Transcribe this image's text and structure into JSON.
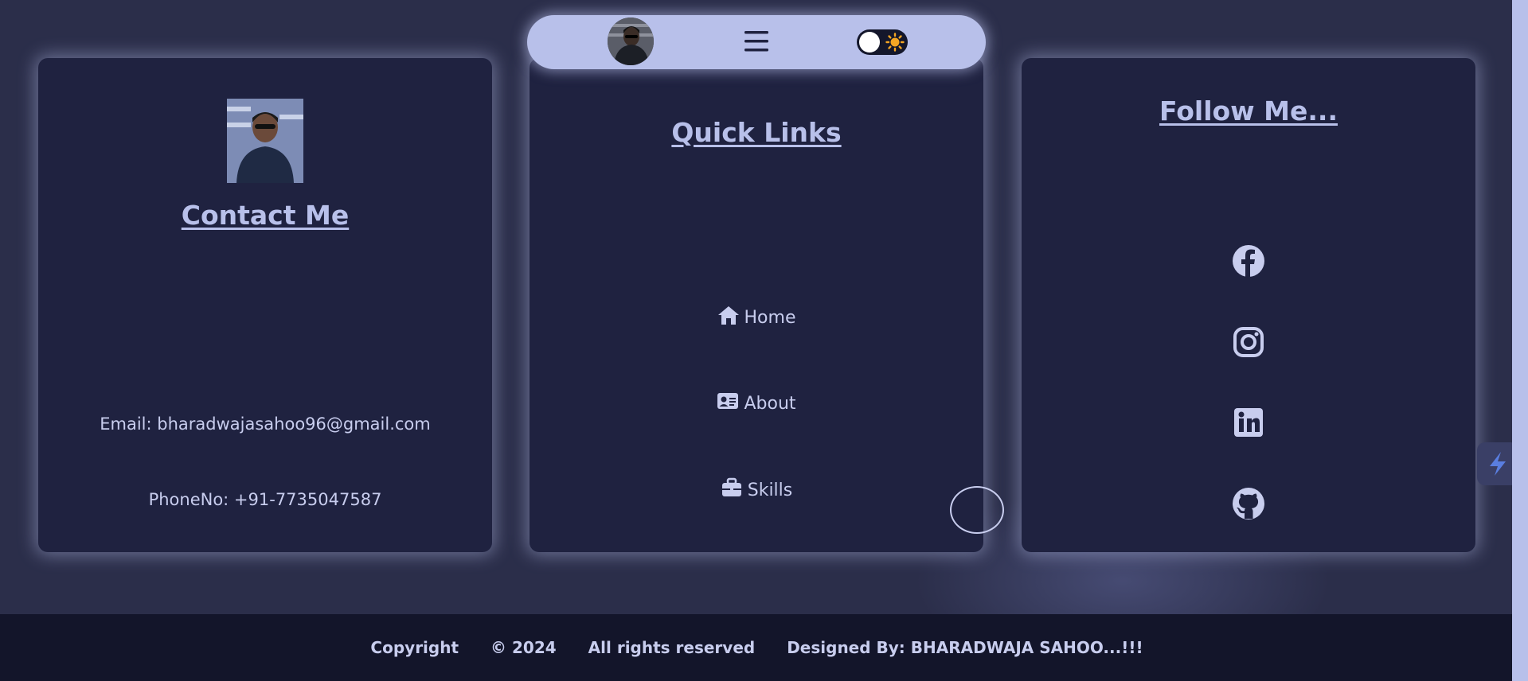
{
  "contact": {
    "heading": "Contact Me",
    "email": "Email: bharadwajasahoo96@gmail.com",
    "phone": "PhoneNo: +91-7735047587"
  },
  "quick_links": {
    "heading": "Quick Links",
    "items": [
      {
        "label": "Home",
        "icon": "home-icon"
      },
      {
        "label": "About",
        "icon": "id-card-icon"
      },
      {
        "label": "Skills",
        "icon": "briefcase-icon"
      }
    ]
  },
  "follow": {
    "heading": "Follow Me...",
    "icons": [
      "facebook-icon",
      "instagram-icon",
      "linkedin-icon",
      "github-icon"
    ]
  },
  "footer": {
    "copyright": "Copyright",
    "year": "© 2024",
    "rights": "All rights reserved",
    "designer": "Designed By: BHARADWAJA SAHOO...!!!"
  },
  "colors": {
    "background": "#2b2e4a",
    "card": "#1f2240",
    "accent": "#b8c0ea",
    "footer": "#13152a",
    "sun": "#f5a623"
  }
}
